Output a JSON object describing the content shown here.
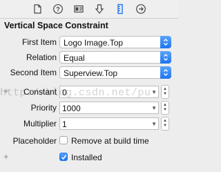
{
  "tabs": [
    {
      "icon": "file-icon"
    },
    {
      "icon": "help-icon"
    },
    {
      "icon": "identity-icon"
    },
    {
      "icon": "attributes-icon"
    },
    {
      "icon": "size-icon",
      "selected": true
    },
    {
      "icon": "connections-icon"
    }
  ],
  "section_title": "Vertical Space Constraint",
  "first_item": {
    "label": "First Item",
    "value": "Logo Image.Top"
  },
  "relation": {
    "label": "Relation",
    "value": "Equal"
  },
  "second_item": {
    "label": "Second Item",
    "value": "Superview.Top"
  },
  "constant": {
    "label": "Constant",
    "value": "0"
  },
  "priority": {
    "label": "Priority",
    "value": "1000"
  },
  "multiplier": {
    "label": "Multiplier",
    "value": "1"
  },
  "placeholder": {
    "label": "Placeholder",
    "checkbox_label": "Remove at build time",
    "checked": false
  },
  "installed": {
    "label": "Installed",
    "checked": true
  },
  "watermark": "http://blog.csdn.net/pu",
  "colors": {
    "accent": "#1f74f2",
    "background": "#ededed"
  }
}
